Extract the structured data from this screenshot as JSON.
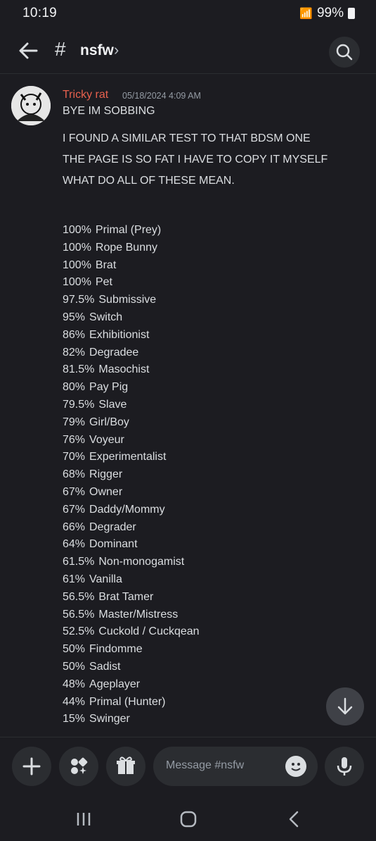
{
  "status": {
    "time": "10:19",
    "battery": "99%"
  },
  "header": {
    "channel": "nsfw"
  },
  "message": {
    "author": "Tricky rat",
    "timestamp": "05/18/2024 4:09 AM",
    "lines": [
      "BYE IM SOBBING",
      "I FOUND A SIMILAR TEST TO THAT BDSM ONE",
      "THE PAGE IS SO FAT I HAVE TO COPY IT MYSELF",
      "WHAT DO ALL OF THESE MEAN."
    ],
    "results": [
      {
        "pct": "100%",
        "label": "Primal (Prey)"
      },
      {
        "pct": "100%",
        "label": "Rope Bunny"
      },
      {
        "pct": "100%",
        "label": "Brat"
      },
      {
        "pct": "100%",
        "label": "Pet"
      },
      {
        "pct": "97.5%",
        "label": "Submissive"
      },
      {
        "pct": "95%",
        "label": "Switch"
      },
      {
        "pct": "86%",
        "label": "Exhibitionist"
      },
      {
        "pct": "82%",
        "label": "Degradee"
      },
      {
        "pct": "81.5%",
        "label": "Masochist"
      },
      {
        "pct": "80%",
        "label": "Pay Pig"
      },
      {
        "pct": "79.5%",
        "label": "Slave"
      },
      {
        "pct": "79%",
        "label": "Girl/Boy"
      },
      {
        "pct": "76%",
        "label": "Voyeur"
      },
      {
        "pct": "70%",
        "label": "Experimentalist"
      },
      {
        "pct": "68%",
        "label": "Rigger"
      },
      {
        "pct": "67%",
        "label": "Owner"
      },
      {
        "pct": "67%",
        "label": "Daddy/Mommy"
      },
      {
        "pct": "66%",
        "label": "Degrader"
      },
      {
        "pct": "64%",
        "label": "Dominant"
      },
      {
        "pct": "61.5%",
        "label": "Non-monogamist"
      },
      {
        "pct": "61%",
        "label": "Vanilla"
      },
      {
        "pct": "56.5%",
        "label": "Brat Tamer"
      },
      {
        "pct": "56.5%",
        "label": "Master/Mistress"
      },
      {
        "pct": "52.5%",
        "label": "Cuckold / Cuckqean"
      },
      {
        "pct": "50%",
        "label": "Findomme"
      },
      {
        "pct": "50%",
        "label": "Sadist"
      },
      {
        "pct": "48%",
        "label": "Ageplayer"
      },
      {
        "pct": "44%",
        "label": "Primal (Hunter)"
      },
      {
        "pct": "15%",
        "label": "Swinger"
      }
    ]
  },
  "composer": {
    "placeholder": "Message #nsfw"
  },
  "colors": {
    "author": "#e8614e",
    "background": "#1c1c21",
    "text": "#dbdee1"
  }
}
